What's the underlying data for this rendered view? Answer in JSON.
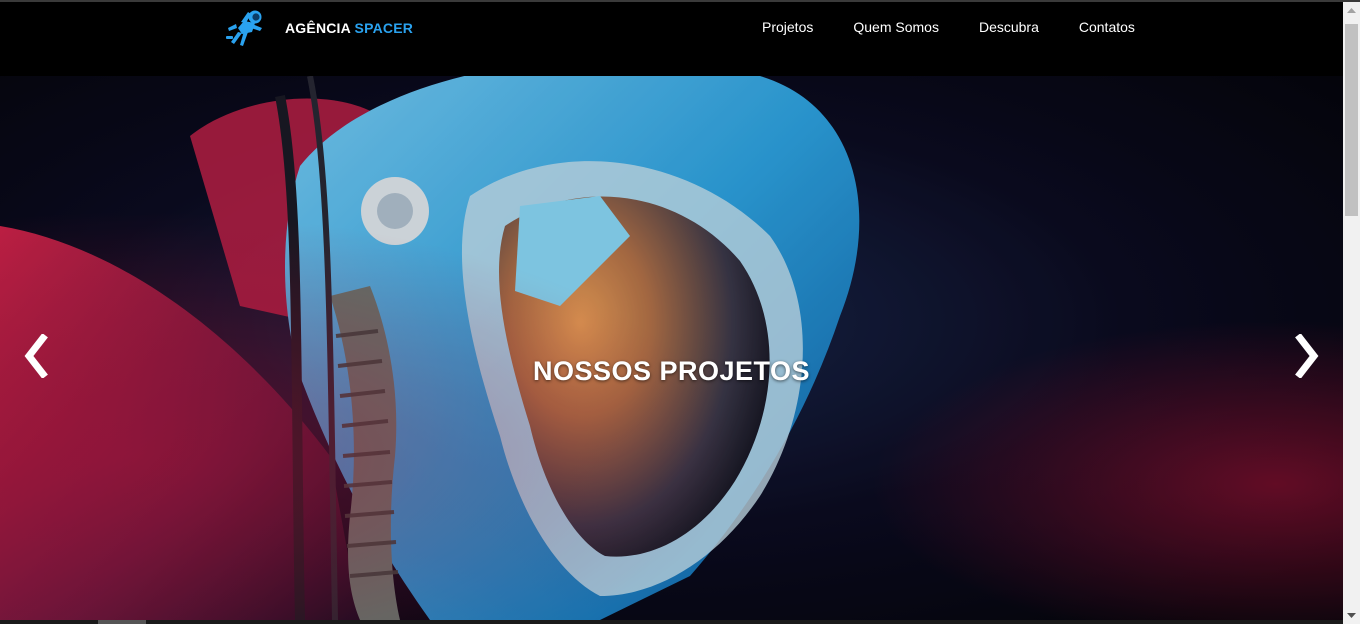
{
  "navbar": {
    "brand_part1": "AGÊNCIA",
    "brand_part2": "SPACER",
    "logo_icon": "astronaut-icon",
    "links": [
      {
        "label": "Projetos"
      },
      {
        "label": "Quem Somos"
      },
      {
        "label": "Descubra"
      },
      {
        "label": "Contatos"
      }
    ]
  },
  "hero": {
    "title": "NOSSOS PROJETOS",
    "prev_icon": "chevron-left-icon",
    "next_icon": "chevron-right-icon"
  },
  "colors": {
    "accent": "#2aa2ef",
    "navbar_bg": "#000000",
    "text": "#ffffff"
  }
}
